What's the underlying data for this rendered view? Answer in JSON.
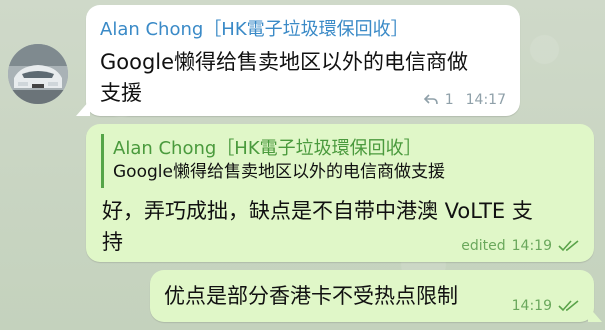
{
  "messages": [
    {
      "sender": "Alan Chong",
      "group": "［HK電子垃圾環保回收］",
      "text_line1": "Google懒得给售卖地区以外的电信商做",
      "text_line2": "支援",
      "reply_count": "1",
      "time": "14:17"
    },
    {
      "quote_sender": "Alan Chong",
      "quote_group": "［HK電子垃圾環保回收］",
      "quote_text": "Google懒得给售卖地区以外的电信商做支援",
      "text_line1": "好，弄巧成拙，缺点是不自带中港澳 VoLTE 支",
      "text_line2": "持",
      "edited_label": "edited",
      "time": "14:19"
    },
    {
      "text": "优点是部分香港卡不受热点限制",
      "time": "14:19"
    }
  ],
  "colors": {
    "incoming_bg": "#ffffff",
    "outgoing_bg": "#e0f7c8",
    "sender_name": "#3a8ac7",
    "quote_accent": "#55a548",
    "read_checks": "#5aa34a"
  }
}
